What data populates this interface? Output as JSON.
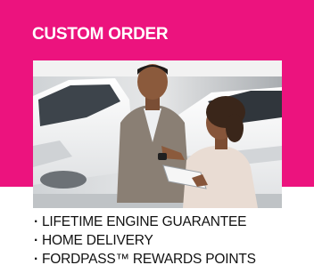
{
  "promo": {
    "title": "CUSTOM ORDER",
    "image_alt": "Salesperson and customer reviewing paperwork beside a white car in a showroom",
    "bullet_glyph": "·",
    "benefits": [
      "LIFETIME ENGINE GUARANTEE",
      "HOME DELIVERY",
      "FORDPASS™ REWARDS POINTS"
    ]
  },
  "colors": {
    "brand_pink": "#ec137e",
    "text_dark": "#111111",
    "background": "#ffffff"
  }
}
